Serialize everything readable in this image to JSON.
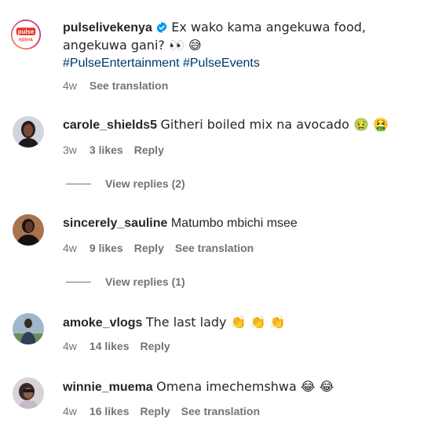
{
  "post": {
    "username": "pulselivekenya",
    "verified": true,
    "caption": "Ex wako kama angekuwa food, angekuwa gani? 👀 😅",
    "hashtags": [
      "#PulseEntertainment",
      "#PulseEvents"
    ],
    "age": "4w",
    "see_translation": "See translation",
    "avatar_logo_top": "pulse",
    "avatar_logo_bottom": "KENYA"
  },
  "comments": [
    {
      "username": "carole_shields5",
      "text": "Githeri boiled mix na avocado 🤢 🤮",
      "age": "3w",
      "likes": "3 likes",
      "reply": "Reply",
      "see_translation": "",
      "view_replies": "View replies (2)"
    },
    {
      "username": "sincerely_sauline",
      "text": "Matumbo mbichi msee",
      "age": "4w",
      "likes": "9 likes",
      "reply": "Reply",
      "see_translation": "See translation",
      "view_replies": "View replies (1)"
    },
    {
      "username": "amoke_vlogs",
      "text": "The last lady 👏 👏 👏",
      "age": "4w",
      "likes": "14 likes",
      "reply": "Reply",
      "see_translation": "",
      "view_replies": ""
    },
    {
      "username": "winnie_muema",
      "text": "Omena imechemshwa 😂 😂",
      "age": "4w",
      "likes": "16 likes",
      "reply": "Reply",
      "see_translation": "See translation",
      "view_replies": ""
    }
  ],
  "colors": {
    "text": "#262626",
    "secondary": "#737373",
    "link": "#00376b",
    "verified": "#0095f6",
    "pulse_red": "#e4312b"
  }
}
